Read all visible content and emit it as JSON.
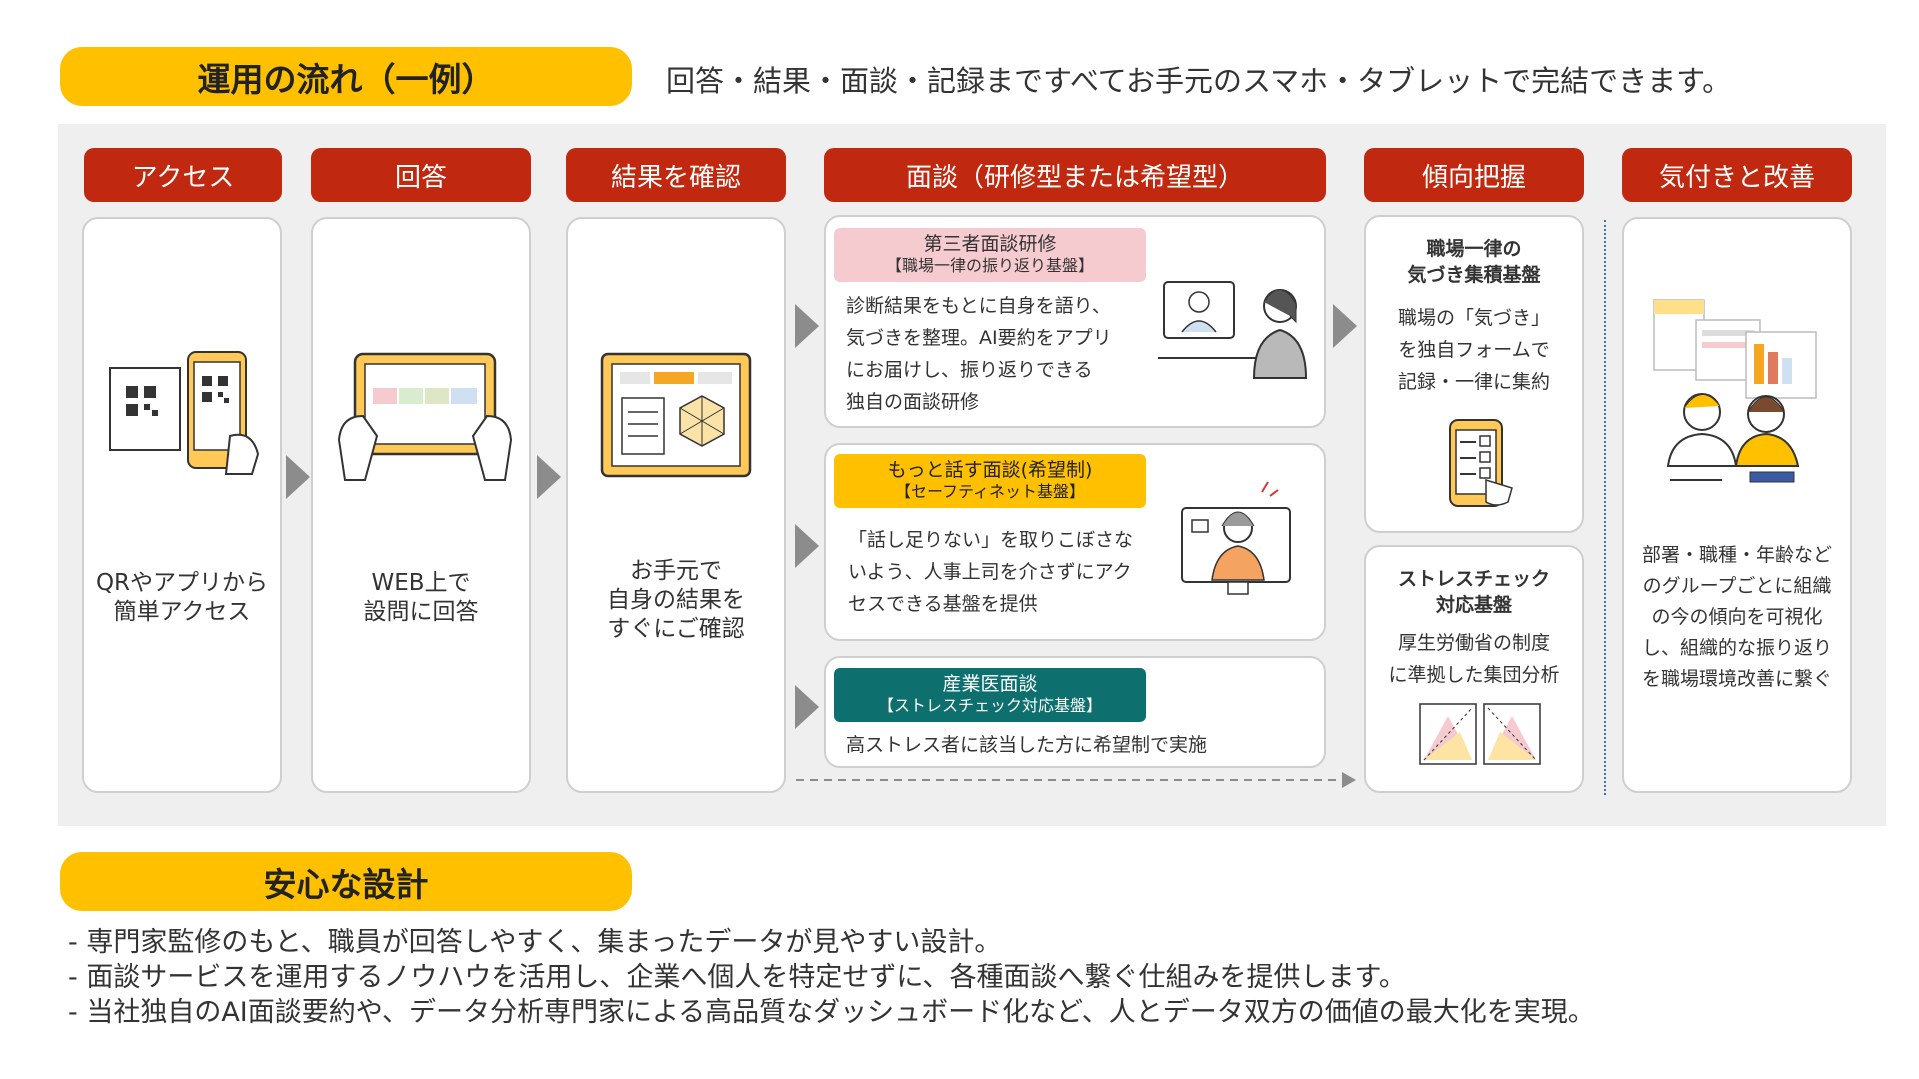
{
  "flow": {
    "heading": "運用の流れ（一例）",
    "subtitle": "回答・結果・面談・記録まですべてお手元のスマホ・タブレットで完結できます。",
    "steps": [
      {
        "header": "アクセス",
        "text": "QRやアプリから\n簡単アクセス"
      },
      {
        "header": "回答",
        "text": "WEB上で\n設問に回答"
      },
      {
        "header": "結果を確認",
        "text": "お手元で\n自身の結果を\nすぐにご確認"
      },
      {
        "header": "面談（研修型または希望型）"
      },
      {
        "header": "傾向把握"
      },
      {
        "header": "気付きと改善",
        "text": "部署・職種・年齢など\nのグループごとに組織\nの今の傾向を可視化\nし、組織的な振り返り\nを職場環境改善に繋ぐ"
      }
    ],
    "interviews": [
      {
        "title": "第三者面談研修",
        "subtitle": "【職場一律の振り返り基盤】",
        "text": "診断結果をもとに自身を語り、\n気づきを整理。AI要約をアプリ\nにお届けし、振り返りできる\n独自の面談研修",
        "tag_color": "#f6cbd0"
      },
      {
        "title": "もっと話す面談(希望制)",
        "subtitle": "【セーフティネット基盤】",
        "text": "「話し足りない」を取りこぼさな\nいよう、人事上司を介さずにアク\nセスできる基盤を提供",
        "tag_color": "#ffc000"
      },
      {
        "title": "産業医面談",
        "subtitle": "【ストレスチェック対応基盤】",
        "text": "高ストレス者に該当した方に希望制で実施",
        "tag_color": "#0e6f6f"
      }
    ],
    "trend": [
      {
        "title": "職場一律の\n気づき集積基盤",
        "text": "職場の「気づき」\nを独自フォームで\n記録・一律に集約"
      },
      {
        "title": "ストレスチェック\n対応基盤",
        "text": "厚生労働省の制度\nに準拠した集団分析"
      }
    ]
  },
  "design": {
    "heading": "安心な設計",
    "bullets": [
      "- 専門家監修のもと、職員が回答しやすく、集まったデータが見やすい設計。",
      "- 面談サービスを運用するノウハウを活用し、企業へ個人を特定せずに、各種面談へ繋ぐ仕組みを提供します。",
      "- 当社独自のAI面談要約や、データ分析専門家による高品質なダッシュボード化など、人とデータ双方の価値の最大化を実現。"
    ]
  },
  "colors": {
    "header_red": "#c0280f",
    "accent_yellow": "#ffc000",
    "teal": "#0e6f6f",
    "pink": "#f6cbd0"
  }
}
